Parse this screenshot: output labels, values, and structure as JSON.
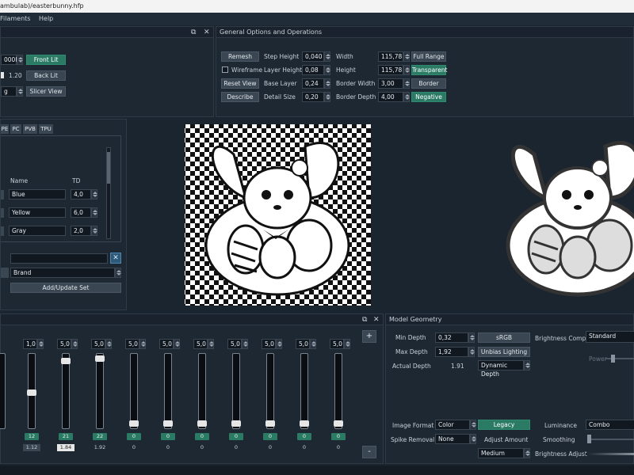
{
  "window": {
    "title": "ambulab)/easterbunny.hfp"
  },
  "menu": [
    "Filaments",
    "Help"
  ],
  "top_left": {
    "field_value": "000K",
    "front_lit": "Front Lit",
    "back_lit": "Back Lit",
    "value_120": "1.20",
    "combo_value": "g",
    "slicer_view": "Slicer View"
  },
  "general": {
    "title": "General Options and Operations",
    "remesh": "Remesh",
    "wireframe": "Wireframe",
    "reset_view": "Reset View",
    "describe": "Describe",
    "step_height_label": "Step Height",
    "step_height": "0,040",
    "layer_height_label": "Layer Height",
    "layer_height": "0,08",
    "base_layer_label": "Base Layer",
    "base_layer": "0,24",
    "detail_size_label": "Detail Size",
    "detail_size": "0,20",
    "width_label": "Width",
    "width": "115,78",
    "height_label": "Height",
    "height": "115,78",
    "border_width_label": "Border Width",
    "border_width": "3,00",
    "border_depth_label": "Border Depth",
    "border_depth": "4,00",
    "full_range": "Full Range",
    "transparent": "Transparent",
    "border": "Border",
    "negative": "Negative"
  },
  "filaments": {
    "tabs": [
      "PE",
      "PC",
      "PVB",
      "TPU"
    ],
    "name_header": "Name",
    "td_header": "TD",
    "rows": [
      {
        "name": "Blue",
        "td": "4,0"
      },
      {
        "name": "Yellow",
        "td": "6,0"
      },
      {
        "name": "Gray",
        "td": "2,0"
      }
    ],
    "brand": "Brand",
    "add_update": "Add/Update Set"
  },
  "layers": {
    "columns": [
      {
        "top": "",
        "badge": "",
        "val": ""
      },
      {
        "top": "1,0",
        "badge": "12",
        "val": "1.12"
      },
      {
        "top": "5,0",
        "badge": "21",
        "val": "1.84"
      },
      {
        "top": "5,0",
        "badge": "22",
        "val": "1.92"
      },
      {
        "top": "5,0",
        "badge": "0",
        "val": "0"
      },
      {
        "top": "5,0",
        "badge": "0",
        "val": "0"
      },
      {
        "top": "5,0",
        "badge": "0",
        "val": "0"
      },
      {
        "top": "5,0",
        "badge": "0",
        "val": "0"
      },
      {
        "top": "5,0",
        "badge": "0",
        "val": "0"
      },
      {
        "top": "5,0",
        "badge": "0",
        "val": "0"
      },
      {
        "top": "5,0",
        "badge": "0",
        "val": "0"
      }
    ],
    "plus": "+",
    "minus": "-"
  },
  "model": {
    "title": "Model Geometry",
    "min_depth_label": "Min Depth",
    "min_depth": "0,32",
    "max_depth_label": "Max Depth",
    "max_depth": "1,92",
    "actual_depth_label": "Actual Depth",
    "actual_depth": "1.91",
    "srgb": "sRGB",
    "unbias": "Unbias Lighting",
    "dynamic_depth": "Dynamic Depth",
    "brightness_comp_label": "Brightness Comp",
    "brightness_comp": "Standard",
    "power_label": "Power",
    "image_format_label": "Image Format",
    "image_format": "Color",
    "legacy": "Legacy",
    "luminance_label": "Luminance",
    "luminance": "Combo",
    "spike_removal_label": "Spike Removal",
    "spike_removal": "None",
    "adjust_amount_label": "Adjust Amount",
    "smoothing_label": "Smoothing",
    "medium": "Medium",
    "brightness_adjust_label": "Brightness Adjust"
  },
  "colors": {
    "accent": "#2a7a64",
    "bg": "#1b2530",
    "panel": "#1e2833"
  }
}
